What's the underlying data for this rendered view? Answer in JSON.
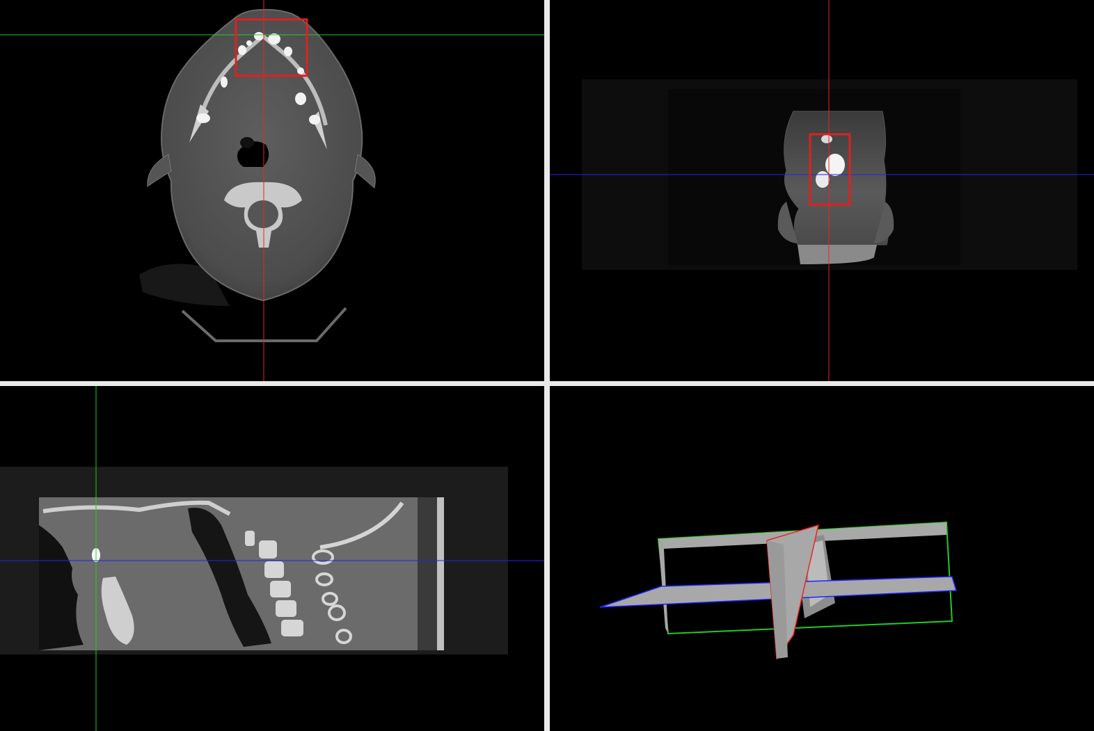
{
  "viewer": {
    "colors": {
      "background": "#000000",
      "divider": "#e9e9e9",
      "axial_plane": "#2222ff",
      "coronal_plane": "#22cc22",
      "sagittal_plane": "#ee2222",
      "roi_box": "#e02020",
      "plane_fill": "#a8a8a8"
    },
    "viewports": [
      {
        "id": "axial",
        "plane": "axial",
        "crosshair_colors": [
          "#22cc22",
          "#ee2222"
        ]
      },
      {
        "id": "coronal",
        "plane": "coronal",
        "crosshair_colors": [
          "#2222ff",
          "#ee2222"
        ]
      },
      {
        "id": "sagittal",
        "plane": "sagittal",
        "crosshair_colors": [
          "#2222ff",
          "#22cc22"
        ]
      },
      {
        "id": "3d",
        "plane": "3d-orthogonal-slices"
      }
    ],
    "icons": [
      "crosshair",
      "roi-box"
    ]
  }
}
